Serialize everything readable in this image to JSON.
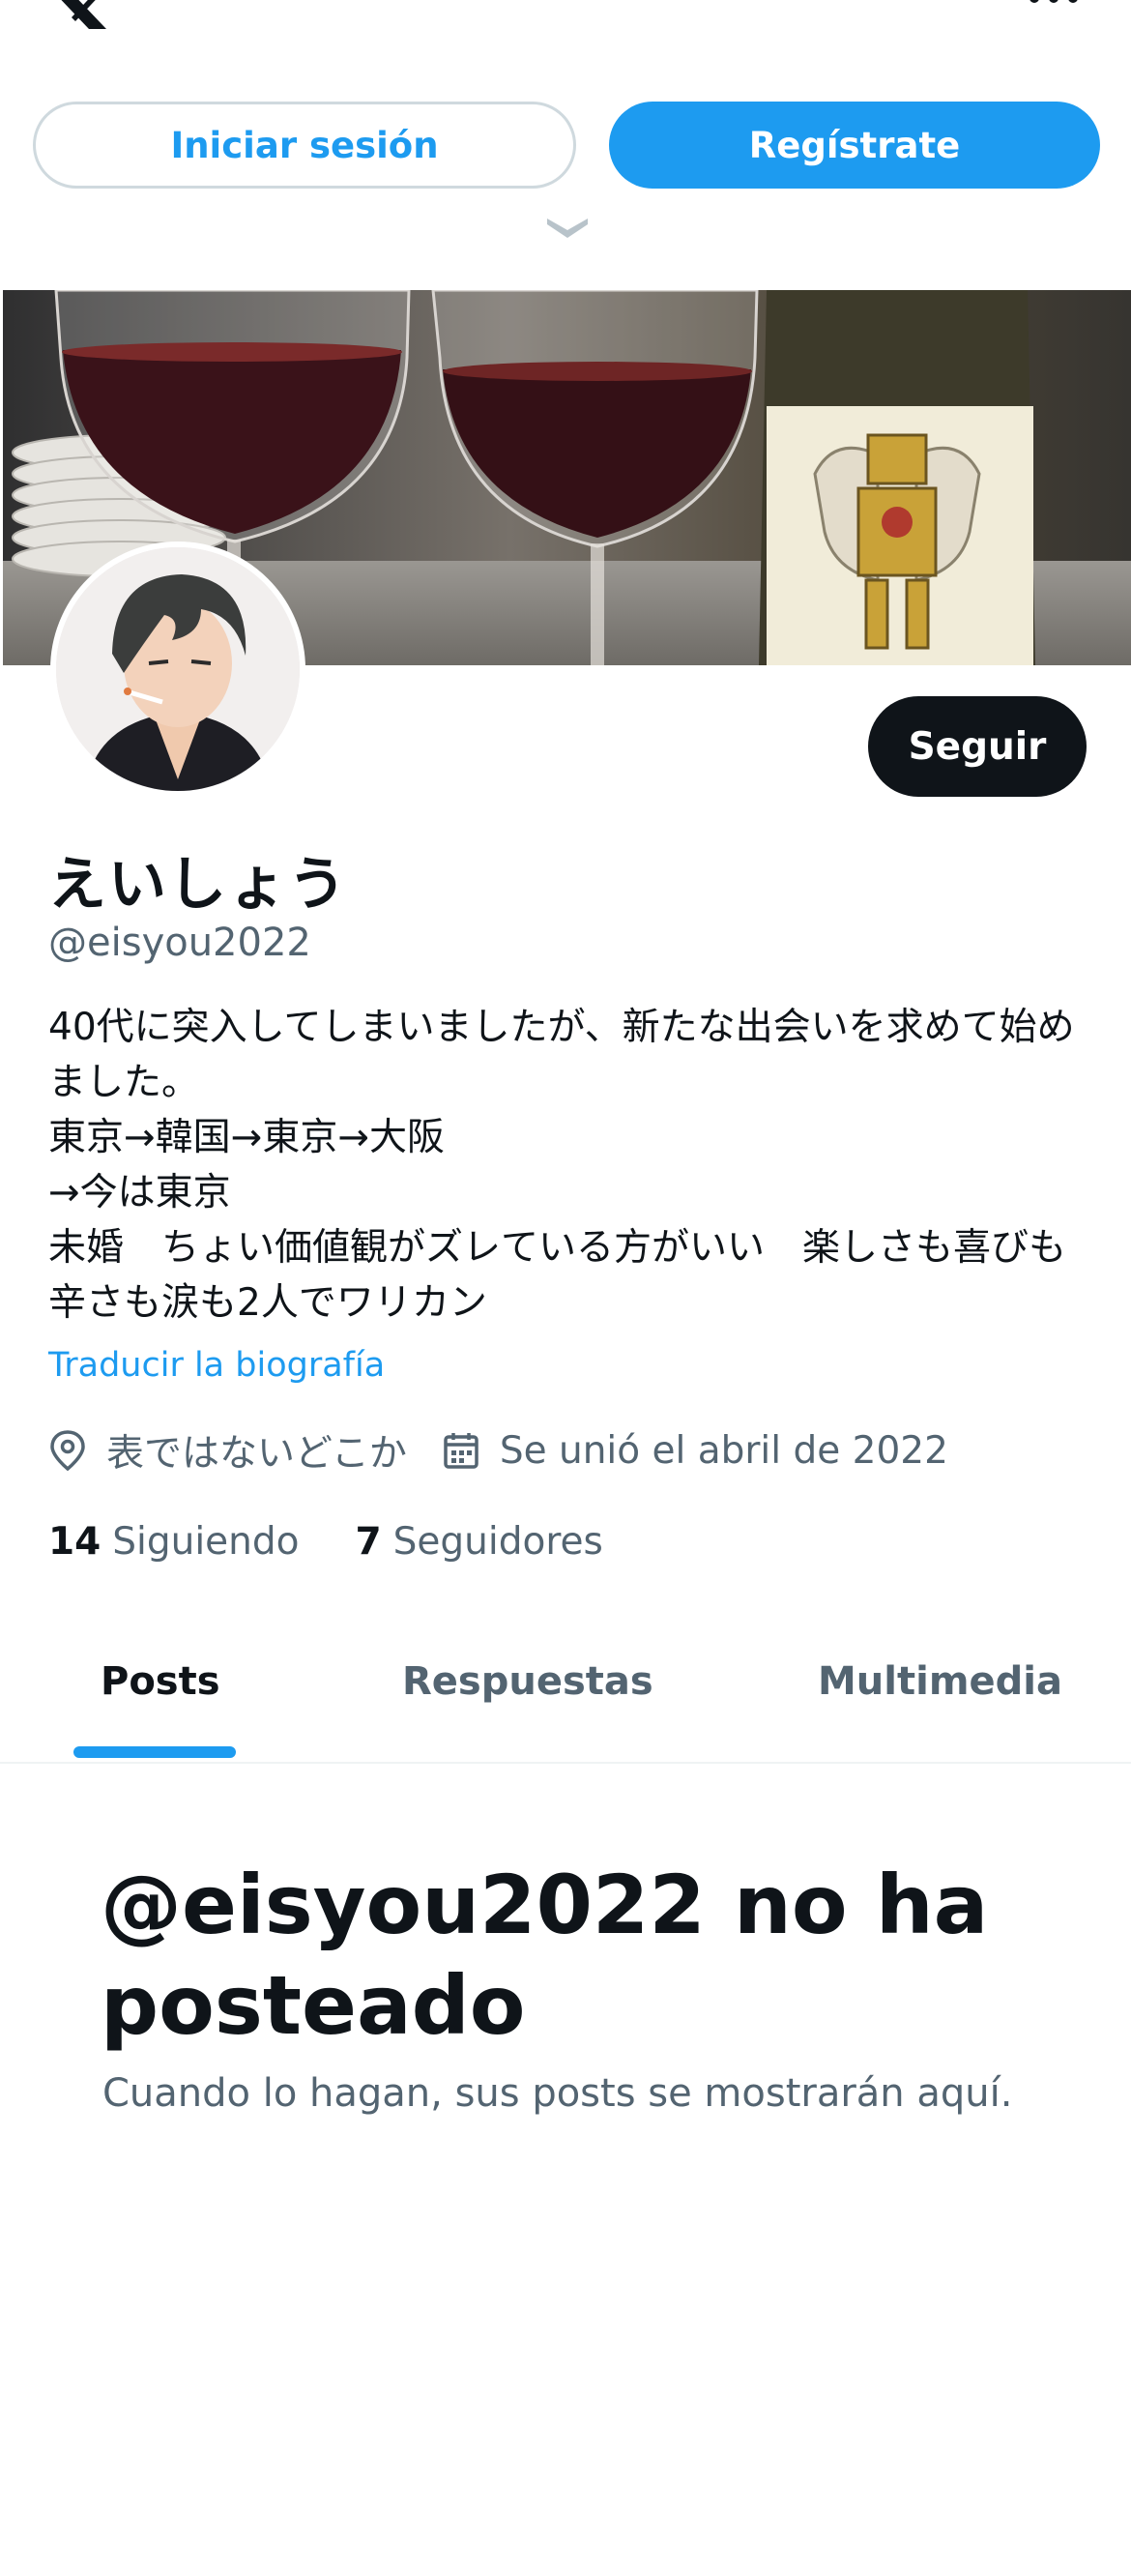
{
  "header": {
    "logo_icon": "x-logo-icon",
    "more_icon": "more-icon",
    "login_label": "Iniciar sesión",
    "register_label": "Regístrate",
    "expand_icon": "chevron-down-icon"
  },
  "colors": {
    "accent": "#1d9bf0",
    "text_primary": "#0f1419",
    "text_secondary": "#536471",
    "button_dark": "#0f1419"
  },
  "profile": {
    "display_name": "えいしょう",
    "handle": "@eisyou2022",
    "follow_label": "Seguir",
    "bio": "40代に突入してしまいましたが、新たな出会いを求めて始めました。\n東京→韓国→東京→大阪\n→今は東京\n未婚　ちょい価値観がズレている方がいい　楽しさも喜びも辛さも涙も2人でワリカン",
    "translate_label": "Traducir la biografía",
    "location": "表ではないどこか",
    "joined": "Se unió el abril de 2022",
    "following_count": "14",
    "following_label": "Siguiendo",
    "followers_count": "7",
    "followers_label": "Seguidores"
  },
  "tabs": [
    {
      "label": "Posts",
      "active": true
    },
    {
      "label": "Respuestas",
      "active": false
    },
    {
      "label": "Multimedia",
      "active": false
    }
  ],
  "empty_state": {
    "title": "@eisyou2022 no ha posteado",
    "subtitle": "Cuando lo hagan, sus posts se mostrarán aquí."
  }
}
